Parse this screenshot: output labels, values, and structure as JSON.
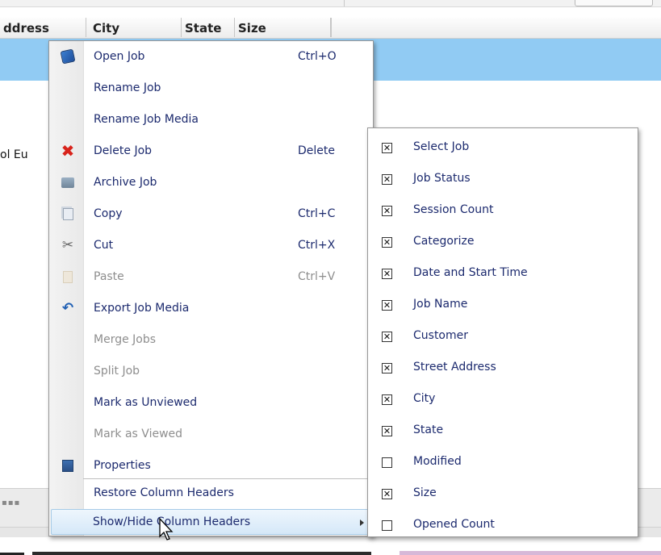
{
  "grid": {
    "headers": [
      "ddress",
      "City",
      "State",
      "Size",
      ""
    ],
    "row_partial_text": "ol Eu"
  },
  "context_menu": {
    "items": [
      {
        "label": "Open Job",
        "shortcut": "Ctrl+O",
        "icon": "open-job-icon",
        "enabled": true
      },
      {
        "label": "Rename Job",
        "shortcut": "",
        "icon": "",
        "enabled": true
      },
      {
        "label": "Rename Job Media",
        "shortcut": "",
        "icon": "",
        "enabled": true
      },
      {
        "label": "Delete Job",
        "shortcut": "Delete",
        "icon": "delete-x-icon",
        "enabled": true
      },
      {
        "label": "Archive Job",
        "shortcut": "",
        "icon": "archive-icon",
        "enabled": true
      },
      {
        "label": "Copy",
        "shortcut": "Ctrl+C",
        "icon": "copy-icon",
        "enabled": true
      },
      {
        "label": "Cut",
        "shortcut": "Ctrl+X",
        "icon": "scissors-icon",
        "enabled": true
      },
      {
        "label": "Paste",
        "shortcut": "Ctrl+V",
        "icon": "paste-icon",
        "enabled": false
      },
      {
        "label": "Export Job Media",
        "shortcut": "",
        "icon": "export-arrow-icon",
        "enabled": true
      },
      {
        "label": "Merge Jobs",
        "shortcut": "",
        "icon": "",
        "enabled": false
      },
      {
        "label": "Split Job",
        "shortcut": "",
        "icon": "",
        "enabled": false
      },
      {
        "label": "Mark as Unviewed",
        "shortcut": "",
        "icon": "",
        "enabled": true
      },
      {
        "label": "Mark as Viewed",
        "shortcut": "",
        "icon": "",
        "enabled": false
      },
      {
        "label": "Properties",
        "shortcut": "",
        "icon": "properties-icon",
        "enabled": true
      },
      {
        "label": "Restore Column Headers",
        "shortcut": "",
        "icon": "",
        "enabled": true
      },
      {
        "label": "Show/Hide Column Headers",
        "shortcut": "",
        "icon": "submenu-arrow-icon",
        "enabled": true
      }
    ]
  },
  "column_submenu": {
    "items": [
      {
        "label": "Select Job",
        "checked": true
      },
      {
        "label": "Job Status",
        "checked": true
      },
      {
        "label": "Session Count",
        "checked": true
      },
      {
        "label": "Categorize",
        "checked": true
      },
      {
        "label": "Date and Start Time",
        "checked": true
      },
      {
        "label": "Job Name",
        "checked": true
      },
      {
        "label": "Customer",
        "checked": true
      },
      {
        "label": "Street Address",
        "checked": true
      },
      {
        "label": "City",
        "checked": true
      },
      {
        "label": "State",
        "checked": true
      },
      {
        "label": "Modified",
        "checked": false
      },
      {
        "label": "Size",
        "checked": true
      },
      {
        "label": "Opened Count",
        "checked": false
      }
    ]
  },
  "colors": {
    "selection_row": "#91cbf3",
    "menu_text": "#1c2a6e",
    "disabled_text": "#8e8e8e",
    "delete_icon": "#d8231b"
  }
}
